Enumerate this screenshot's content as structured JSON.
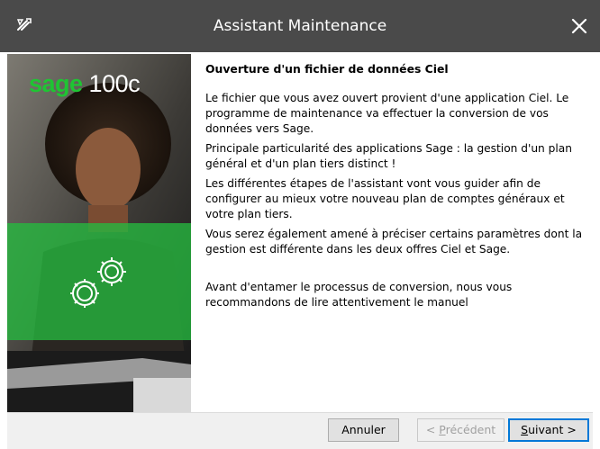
{
  "window": {
    "title": "Assistant Maintenance",
    "app_icon": "sage-tools-icon",
    "close_icon": "close-icon"
  },
  "banner": {
    "logo_brand": "sage",
    "logo_product": " 100c",
    "illustration": "gears-icon"
  },
  "content": {
    "heading": "Ouverture d'un fichier de données Ciel",
    "paragraphs": [
      "Le fichier que vous avez ouvert provient d'une application Ciel. Le programme de maintenance va effectuer la conversion de vos données vers Sage.",
      "Principale particularité des applications Sage : la gestion d'un plan général et d'un plan tiers distinct !",
      "Les différentes étapes de l'assistant vont vous guider afin de configurer au mieux votre nouveau plan de comptes généraux et votre plan tiers.",
      "Vous serez également amené à préciser certains paramètres dont la gestion est différente dans les deux offres Ciel et Sage.",
      "Avant d'entamer le processus de conversion, nous vous recommandons de lire attentivement le manuel"
    ]
  },
  "buttons": {
    "cancel": "Annuler",
    "prev_prefix": "< ",
    "prev_key": "P",
    "prev_rest": "récédent",
    "next_key": "S",
    "next_rest": "uivant >"
  },
  "colors": {
    "titlebar": "#4a4a4a",
    "brand_green": "#1fc433",
    "accent": "#0078d7"
  }
}
